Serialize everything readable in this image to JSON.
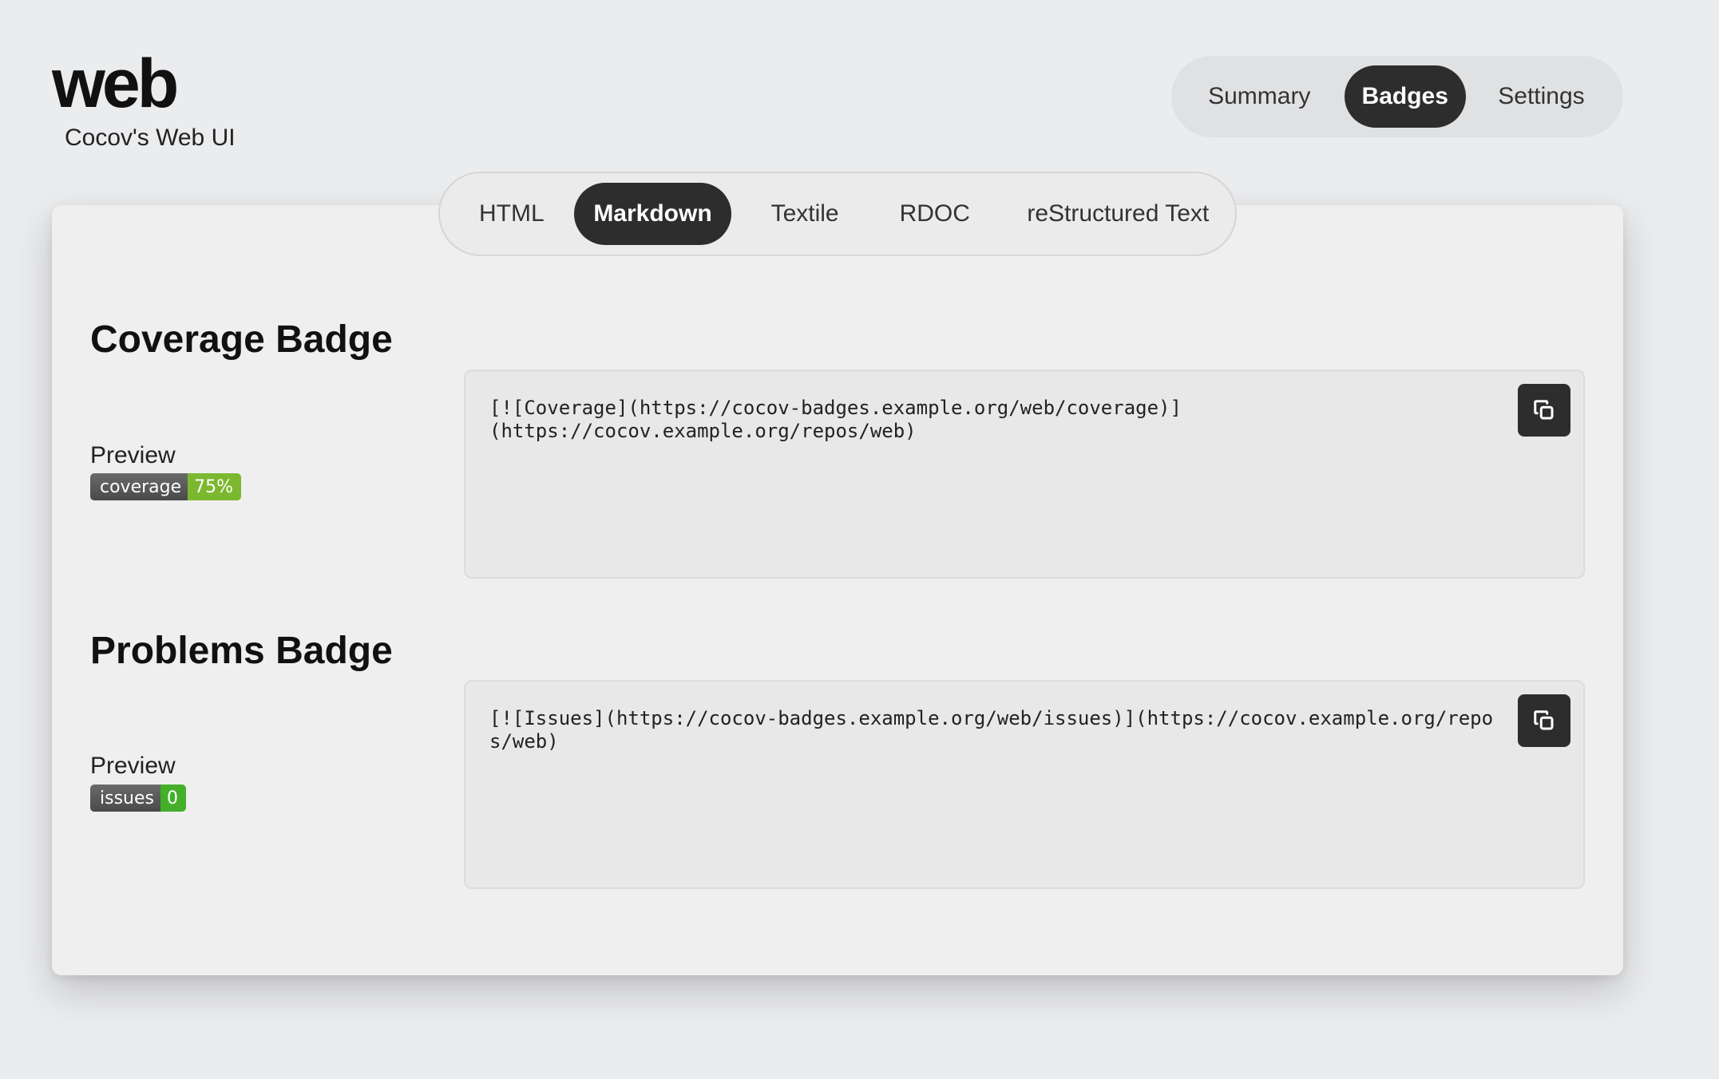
{
  "app": {
    "title": "web",
    "subtitle": "Cocov's Web UI"
  },
  "top_nav": {
    "items": [
      {
        "label": "Summary",
        "active": false
      },
      {
        "label": "Badges",
        "active": true
      },
      {
        "label": "Settings",
        "active": false
      }
    ]
  },
  "format_tabs": {
    "items": [
      {
        "label": "HTML",
        "active": false
      },
      {
        "label": "Markdown",
        "active": true
      },
      {
        "label": "Textile",
        "active": false
      },
      {
        "label": "RDOC",
        "active": false
      },
      {
        "label": "reStructured Text",
        "active": false
      }
    ]
  },
  "sections": [
    {
      "title": "Coverage Badge",
      "preview_label": "Preview",
      "badge": {
        "left": "coverage",
        "right": "75%",
        "right_color": "#7cb82f"
      },
      "code": "[![Coverage](https://cocov-badges.example.org/web/coverage)]\n(https://cocov.example.org/repos/web)",
      "copy_icon": "copy-icon"
    },
    {
      "title": "Problems Badge",
      "preview_label": "Preview",
      "badge": {
        "left": "issues",
        "right": "0",
        "right_color": "#44b02a"
      },
      "code": "[![Issues](https://cocov-badges.example.org/web/issues)](https://cocov.example.org/repos/web)",
      "copy_icon": "copy-icon"
    }
  ],
  "colors": {
    "background": "#ebecee",
    "card": "#efefef",
    "active_pill": "#2d2d2d",
    "code_box": "#e8e8e8"
  }
}
